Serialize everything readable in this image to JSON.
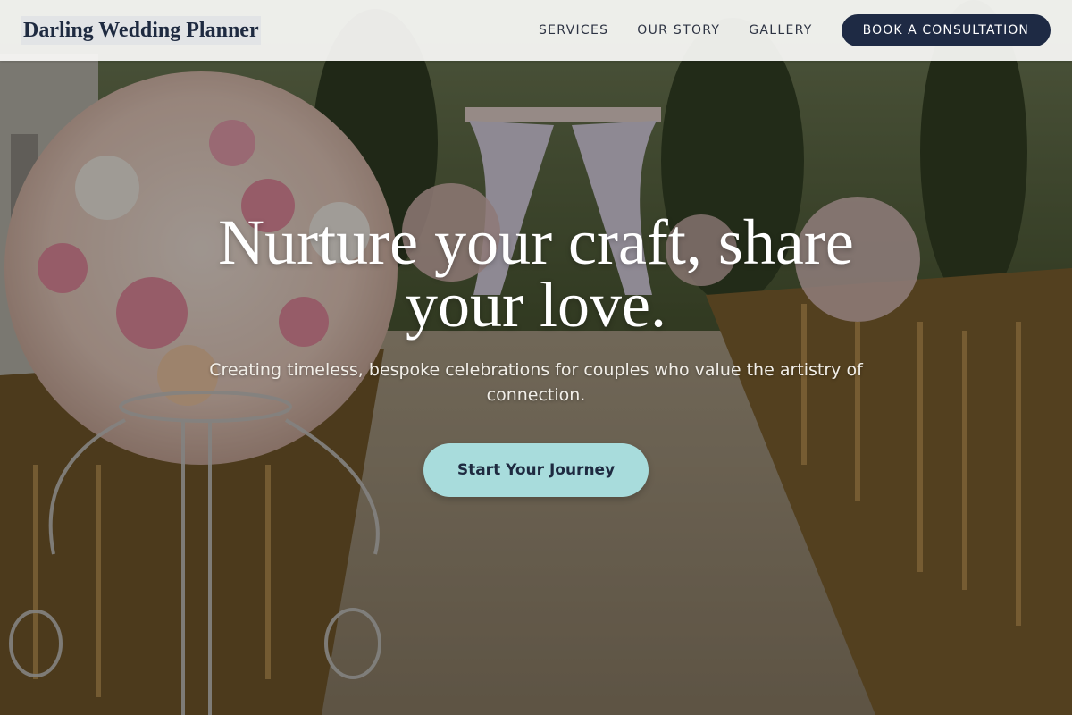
{
  "header": {
    "brand": "Darling Wedding Planner",
    "nav": [
      {
        "label": "SERVICES"
      },
      {
        "label": "OUR STORY"
      },
      {
        "label": "GALLERY"
      }
    ],
    "cta_label": "BOOK A CONSULTATION"
  },
  "hero": {
    "title": "Nurture your craft, share your love.",
    "subtitle": "Creating timeless, bespoke celebrations for couples who value the artistry of connection.",
    "cta_label": "Start Your Journey",
    "background": "wedding-aisle-photo"
  },
  "colors": {
    "brand_navy": "#1e2a44",
    "accent_teal": "#a8dcdc",
    "header_bg": "#fafaf8"
  }
}
